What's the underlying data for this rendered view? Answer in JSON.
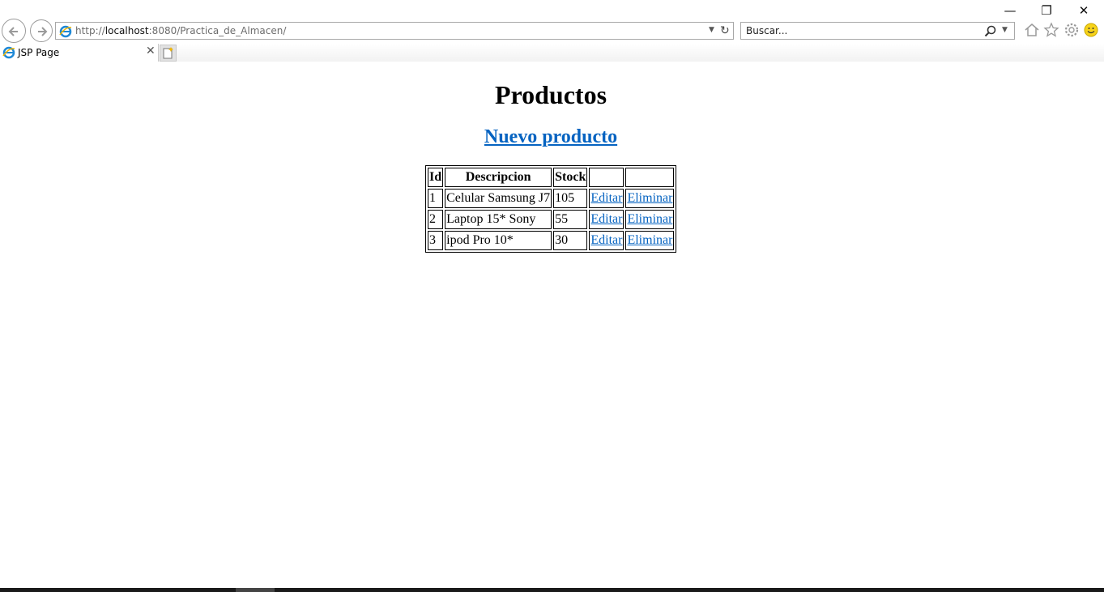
{
  "browser": {
    "url_prefix": "http://",
    "url_host": "localhost",
    "url_rest": ":8080/Practica_de_Almacen/",
    "search_placeholder": "Buscar...",
    "tab_title": "JSP Page",
    "window_controls": {
      "minimize": "—",
      "restore": "❐",
      "close": "✕"
    },
    "icons": [
      "back-icon",
      "forward-icon",
      "ie-logo-icon",
      "refresh-icon",
      "search-icon",
      "home-icon",
      "favorites-star-icon",
      "settings-gear-icon",
      "smiley-feedback-icon",
      "new-tab-icon"
    ]
  },
  "page": {
    "title": "Productos",
    "new_link": "Nuevo producto",
    "table": {
      "headers": [
        "Id",
        "Descripcion",
        "Stock",
        "",
        ""
      ],
      "rows": [
        {
          "id": "1",
          "descripcion": "Celular Samsung J7",
          "stock": "105",
          "edit": "Editar",
          "delete": "Eliminar"
        },
        {
          "id": "2",
          "descripcion": "Laptop 15* Sony",
          "stock": "55",
          "edit": "Editar",
          "delete": "Eliminar"
        },
        {
          "id": "3",
          "descripcion": "ipod Pro 10*",
          "stock": "30",
          "edit": "Editar",
          "delete": "Eliminar"
        }
      ]
    }
  },
  "colors": {
    "link": "#0563c1",
    "text": "#000000",
    "chrome_border": "#a8a8a8"
  }
}
